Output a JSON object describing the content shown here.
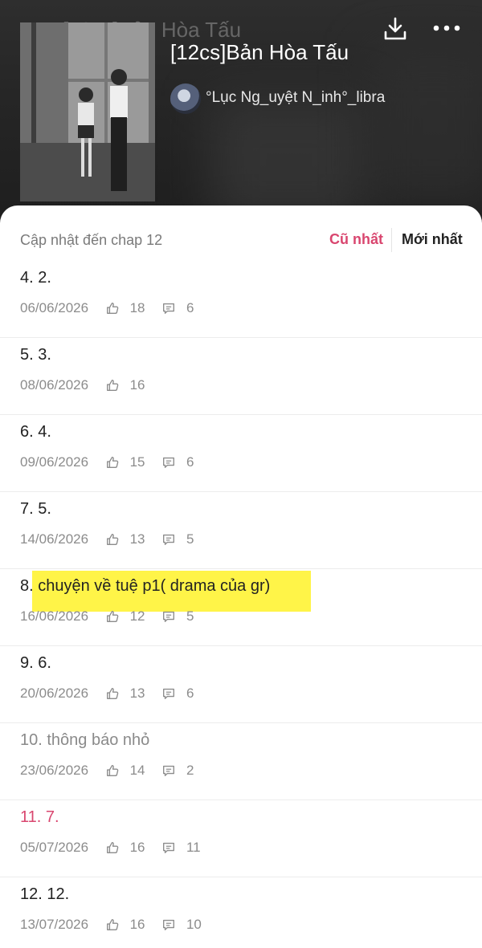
{
  "header": {
    "ghost_title": "[12cs]Bản Hòa Tấu",
    "story_title": "[12cs]Bản Hòa Tấu",
    "author": "°Lục Ng_uyệt N_inh°_libra",
    "background_color": "#262626"
  },
  "sort": {
    "update_label": "Cập nhật đến chap 12",
    "oldest": "Cũ nhất",
    "newest": "Mới nhất",
    "active_color": "#d9466f"
  },
  "chapters": [
    {
      "title": "4. 2.",
      "date": "06/06/2026",
      "likes": "18",
      "comments": "6"
    },
    {
      "title": "5. 3.",
      "date": "08/06/2026",
      "likes": "16",
      "comments": ""
    },
    {
      "title": "6. 4.",
      "date": "09/06/2026",
      "likes": "15",
      "comments": "6"
    },
    {
      "title": "7. 5.",
      "date": "14/06/2026",
      "likes": "13",
      "comments": "5"
    },
    {
      "title": "8. chuyện về tuệ p1( drama của gr)",
      "date": "16/06/2026",
      "likes": "12",
      "comments": "5",
      "highlighted": true
    },
    {
      "title": "9. 6.",
      "date": "20/06/2026",
      "likes": "13",
      "comments": "6"
    },
    {
      "title": "10. thông báo nhỏ",
      "date": "23/06/2026",
      "likes": "14",
      "comments": "2",
      "state": "read"
    },
    {
      "title": "11. 7.",
      "date": "05/07/2026",
      "likes": "16",
      "comments": "11",
      "state": "current"
    },
    {
      "title": "12. 12.",
      "date": "13/07/2026",
      "likes": "16",
      "comments": "10"
    }
  ],
  "icons": [
    "back-arrow-icon",
    "download-icon",
    "more-icon",
    "like-icon",
    "comment-icon"
  ],
  "highlight_color": "#fff228"
}
